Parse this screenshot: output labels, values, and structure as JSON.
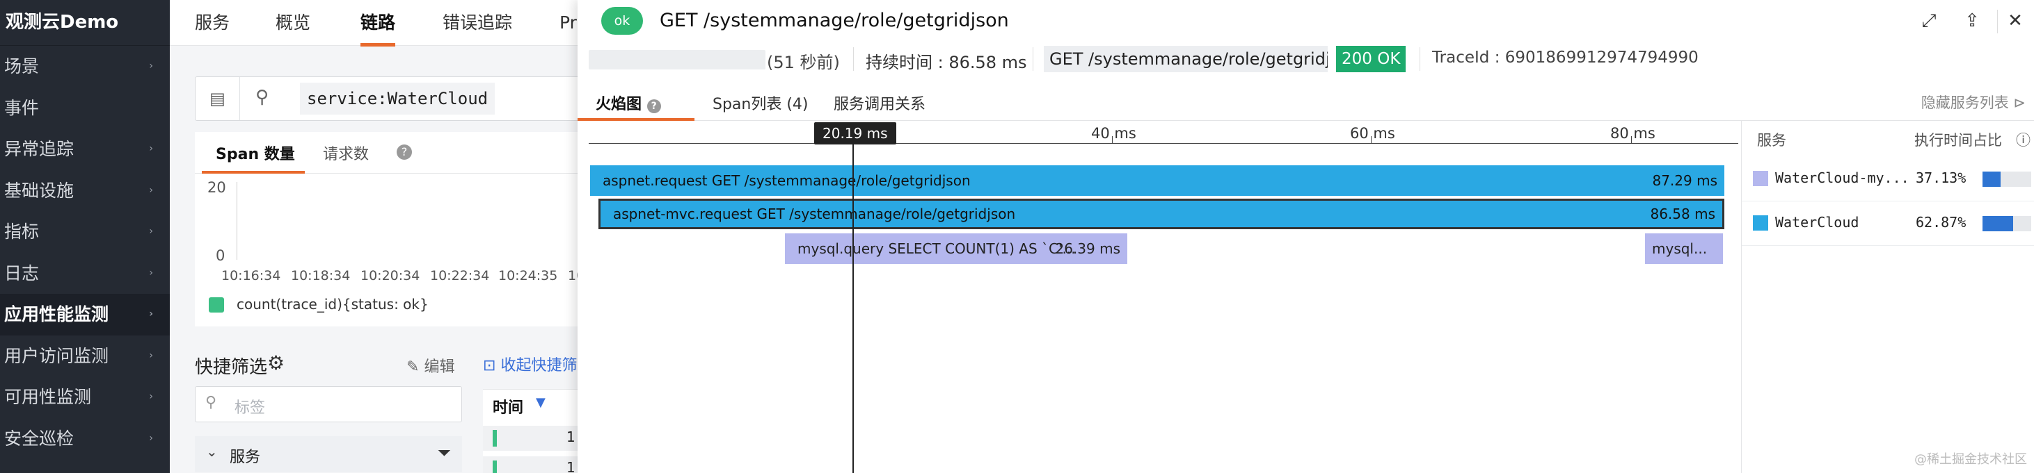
{
  "sidebar": {
    "brand": "观测云Demo",
    "items": [
      {
        "label": "场景",
        "arrow": "›"
      },
      {
        "label": "事件",
        "arrow": ""
      },
      {
        "label": "异常追踪",
        "arrow": "›"
      },
      {
        "label": "基础设施",
        "arrow": "›"
      },
      {
        "label": "指标",
        "arrow": "›"
      },
      {
        "label": "日志",
        "arrow": "›"
      },
      {
        "label": "应用性能监测",
        "arrow": "›"
      },
      {
        "label": "用户访问监测",
        "arrow": "›"
      },
      {
        "label": "可用性监测",
        "arrow": "›"
      },
      {
        "label": "安全巡检",
        "arrow": "›"
      }
    ]
  },
  "topnav": {
    "tabs": [
      "服务",
      "概览",
      "链路",
      "错误追踪",
      "Pr"
    ]
  },
  "search": {
    "query": "service:WaterCloud"
  },
  "chart_tabs": {
    "span_count": "Span 数量",
    "requests": "请求数",
    "help": "?"
  },
  "chart_data": {
    "type": "bar",
    "title": "",
    "yticks": [
      "20",
      "0"
    ],
    "ylim": [
      0,
      20
    ],
    "categories": [
      "10:16:34",
      "10:18:34",
      "10:20:34",
      "10:22:34",
      "10:24:35",
      "10"
    ],
    "series": [
      {
        "name": "count(trace_id){status: ok}",
        "values": []
      }
    ],
    "legend": "bottom-left"
  },
  "quick_filter": {
    "title": "快捷筛选",
    "edit": "编辑",
    "collapse": "收起快捷筛",
    "tag_placeholder": "标签",
    "service_label": "服务"
  },
  "table": {
    "time_header": "时间",
    "row_prefix": "1"
  },
  "drawer": {
    "status_badge": "ok",
    "title": "GET /systemmanage/role/getgridjson",
    "relative_time": "(51 秒前)",
    "duration": "持续时间 : 86.58 ms",
    "request": "GET  /systemmanage/role/getgridj...",
    "http_status": "200 OK",
    "trace_id": "TraceId : 6901869912974794990",
    "tabs": {
      "flame": "火焰图",
      "span_list": "Span列表 (4)",
      "call_graph": "服务调用关系",
      "hide_list": "隐藏服务列表"
    },
    "ruler_labels": [
      "40 ms",
      "60 ms",
      "80 ms"
    ],
    "cursor_label": "20.19 ms",
    "spans": [
      {
        "name": "aspnet.request GET /systemmanage/role/getgridjson",
        "duration": "87.29 ms"
      },
      {
        "name": "aspnet-mvc.request GET /systemmanage/role/getgridjson",
        "duration": "86.58 ms"
      },
      {
        "name": "mysql.query SELECT COUNT(1) AS `C'...",
        "duration": "26.39 ms"
      },
      {
        "name": "mysql...",
        "duration": ""
      }
    ],
    "service_panel": {
      "col_service": "服务",
      "col_ratio": "执行时间占比",
      "rows": [
        {
          "name": "WaterCloud-my...",
          "pct": "37.13%",
          "ratio": 0.3713,
          "color": "#b4b7ee"
        },
        {
          "name": "WaterCloud",
          "pct": "62.87%",
          "ratio": 0.6287,
          "color": "#2aa8e3"
        }
      ]
    }
  },
  "watermark": "@稀土掘金技术社区",
  "colors": {
    "accent": "#e8692c",
    "ok": "#2fb872",
    "service_watercloud": "#2aa8e3",
    "service_mysql": "#b4b7ee"
  }
}
